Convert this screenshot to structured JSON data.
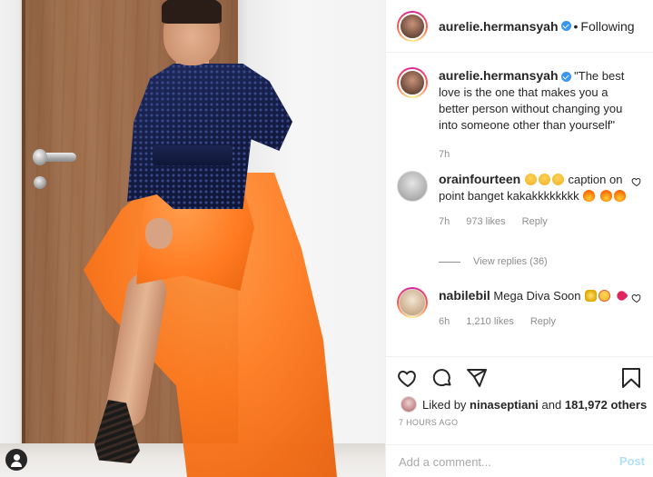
{
  "header": {
    "username": "aurelie.hermansyah",
    "separator": "•",
    "follow_status": "Following"
  },
  "caption": {
    "username": "aurelie.hermansyah",
    "text": "\"The best love is the one that makes you a better person without changing you into someone other than yourself\"",
    "time": "7h"
  },
  "comments": [
    {
      "username": "orainfourteen",
      "text_before": "",
      "text_mid": " caption on point banget kakakkkkkkkk ",
      "time": "7h",
      "likes": "973 likes",
      "reply": "Reply",
      "view_replies": "View replies (36)"
    },
    {
      "username": "nabilebil",
      "text_mid": " Mega Diva Soon",
      "time": "6h",
      "likes": "1,210 likes",
      "reply": "Reply"
    }
  ],
  "likes": {
    "prefix": "Liked by",
    "user": "ninaseptiani",
    "middle": "and",
    "count": "181,972 others"
  },
  "posted_ago": "7 HOURS AGO",
  "comment_box": {
    "placeholder": "Add a comment...",
    "post_label": "Post"
  },
  "icons": {
    "like": "heart-icon",
    "comment": "comment-icon",
    "share": "share-icon",
    "save": "bookmark-icon",
    "tag": "user-tag-icon",
    "verified": "verified-badge-icon"
  },
  "colors": {
    "verified": "#3897f0",
    "post_disabled": "#b2dffc",
    "muted": "#8e8e8e",
    "text": "#262626"
  }
}
